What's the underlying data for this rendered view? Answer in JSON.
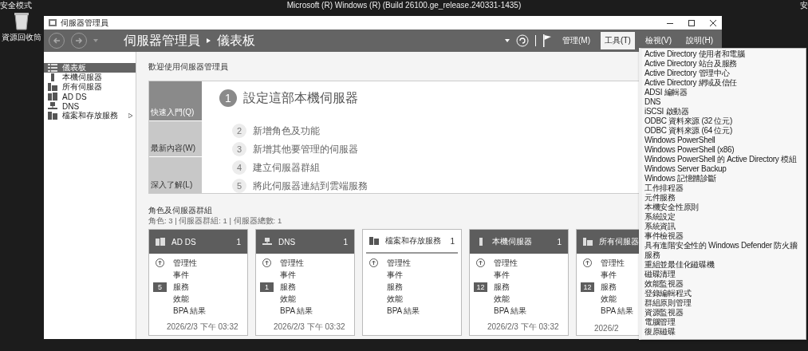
{
  "desktop": {
    "corner_left": "安全模式",
    "corner_right": "安",
    "build": "Microsoft (R) Windows (R) (Build 26100.ge_release.240331-1435)",
    "icons": [
      {
        "label": "資源回收筒"
      }
    ]
  },
  "window": {
    "title": "伺服器管理員"
  },
  "header": {
    "app": "伺服器管理員",
    "page": "儀表板",
    "menus": [
      {
        "label": "管理(M)",
        "selected": false
      },
      {
        "label": "工具(T)",
        "selected": true
      },
      {
        "label": "檢視(V)",
        "selected": false
      },
      {
        "label": "說明(H)",
        "selected": false
      }
    ]
  },
  "sidebar": {
    "items": [
      {
        "label": "儀表板",
        "selected": true,
        "expandable": false
      },
      {
        "label": "本機伺服器",
        "selected": false,
        "expandable": false
      },
      {
        "label": "所有伺服器",
        "selected": false,
        "expandable": false
      },
      {
        "label": "AD DS",
        "selected": false,
        "expandable": false
      },
      {
        "label": "DNS",
        "selected": false,
        "expandable": false
      },
      {
        "label": "檔案和存放服務",
        "selected": false,
        "expandable": true
      }
    ]
  },
  "welcome": {
    "title": "歡迎使用伺服器管理員",
    "tabs": [
      {
        "label": "快速入門(Q)",
        "selected": true
      },
      {
        "label": "最新內容(W)",
        "selected": false
      },
      {
        "label": "深入了解(L)",
        "selected": false
      }
    ],
    "steps": [
      {
        "number": "1",
        "label": "設定這部本機伺服器",
        "primary": true
      },
      {
        "number": "2",
        "label": "新增角色及功能",
        "primary": false
      },
      {
        "number": "3",
        "label": "新增其他要管理的伺服器",
        "primary": false
      },
      {
        "number": "4",
        "label": "建立伺服器群組",
        "primary": false
      },
      {
        "number": "5",
        "label": "將此伺服器連結到雲端服務",
        "primary": false
      }
    ]
  },
  "roles": {
    "title": "角色及伺服器群組",
    "summary": "角色: 3 | 伺服器群組: 1 | 伺服器總數: 1",
    "tiles": [
      {
        "name": "AD DS",
        "count": "1",
        "kind": "dark",
        "rows": [
          {
            "label": "管理性",
            "icon": true
          },
          {
            "label": "事件"
          },
          {
            "label": "服務",
            "badge": "5"
          },
          {
            "label": "效能"
          },
          {
            "label": "BPA 結果"
          }
        ],
        "time": "2026/2/3 下午 03:32"
      },
      {
        "name": "DNS",
        "count": "1",
        "kind": "dark",
        "rows": [
          {
            "label": "管理性",
            "icon": true
          },
          {
            "label": "事件"
          },
          {
            "label": "服務",
            "badge": "1"
          },
          {
            "label": "效能"
          },
          {
            "label": "BPA 結果"
          }
        ],
        "time": "2026/2/3 下午 03:32"
      },
      {
        "name": "檔案和存放服務",
        "count": "1",
        "kind": "light",
        "rows": [
          {
            "label": "管理性",
            "icon": true
          },
          {
            "label": "事件"
          },
          {
            "label": "服務"
          },
          {
            "label": "效能"
          },
          {
            "label": "BPA 結果"
          }
        ]
      },
      {
        "name": "本機伺服器",
        "count": "1",
        "kind": "dark",
        "rows": [
          {
            "label": "管理性",
            "icon": true
          },
          {
            "label": "事件"
          },
          {
            "label": "服務",
            "badge": "12"
          },
          {
            "label": "效能"
          },
          {
            "label": "BPA 結果"
          }
        ],
        "time": "2026/2/3 下午 03:32"
      },
      {
        "name": "所有伺服器",
        "kind": "dark",
        "rows": [
          {
            "label": "管理性",
            "icon": true
          },
          {
            "label": "事件"
          },
          {
            "label": "服務",
            "badge": "12"
          },
          {
            "label": "效能"
          },
          {
            "label": "BPA 結果"
          }
        ],
        "time": "2026/2"
      }
    ]
  },
  "tools_menu": {
    "items": [
      "Active Directory 使用者和電腦",
      "Active Directory 站台及服務",
      "Active Directory 管理中心",
      "Active Directory 網域及信任",
      "ADSI 編輯器",
      "DNS",
      "iSCSI 啟動器",
      "ODBC 資料來源 (32 位元)",
      "ODBC 資料來源 (64 位元)",
      "Windows PowerShell",
      "Windows PowerShell (x86)",
      "Windows PowerShell 的 Active Directory 模組",
      "Windows Server Backup",
      "Windows 記憶體診斷",
      "工作排程器",
      "元件服務",
      "本機安全性原則",
      "系統設定",
      "系統資訊",
      "事件檢視器",
      "具有進階安全性的 Windows Defender 防火牆",
      "服務",
      "重組並最佳化磁碟機",
      "磁碟清理",
      "效能監視器",
      "登錄編輯程式",
      "群組原則管理",
      "資源監視器",
      "電腦管理",
      "復原磁碟"
    ]
  }
}
